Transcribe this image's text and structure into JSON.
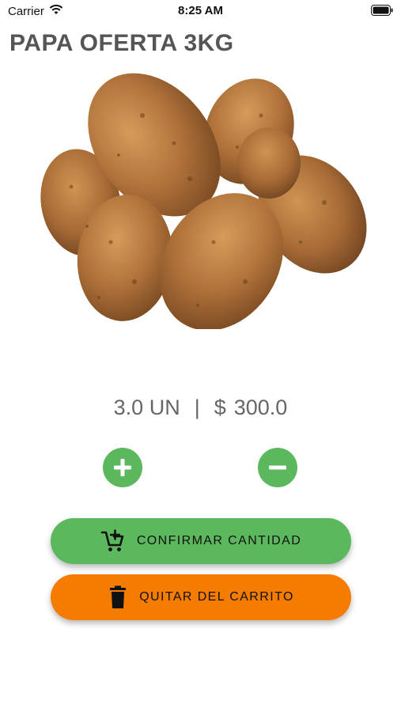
{
  "status_bar": {
    "carrier": "Carrier",
    "time": "8:25 AM",
    "icons": [
      "wifi-icon",
      "battery-icon"
    ]
  },
  "product": {
    "title": "PAPA OFERTA 3KG",
    "image": "potatoes-image"
  },
  "summary": {
    "quantity": "3.0 UN",
    "separator": "|",
    "currency": "$",
    "price": "300.0"
  },
  "stepper": {
    "increment_icon": "plus-icon",
    "decrement_icon": "minus-icon"
  },
  "actions": {
    "confirm_label": "CONFIRMAR CANTIDAD",
    "confirm_icon": "add-to-cart-icon",
    "remove_label": "QUITAR DEL CARRITO",
    "remove_icon": "trash-icon"
  },
  "colors": {
    "green": "#5cb85c",
    "orange": "#f57c00",
    "title_gray": "#555555",
    "summary_gray": "#666666"
  }
}
